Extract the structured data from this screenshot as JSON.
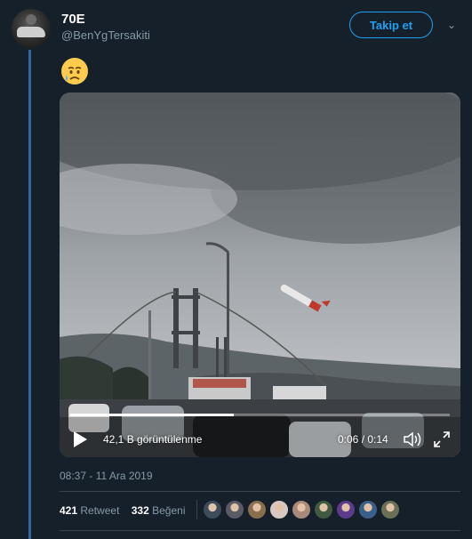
{
  "tweet": {
    "author_name": "70E",
    "author_handle": "@BenYgTersakiti",
    "follow_label": "Takip et",
    "emoji": "crying-face",
    "timestamp": "08:37 - 11 Ara 2019"
  },
  "video": {
    "views": "42,1 B görüntülenme",
    "time": "0:06 / 0:14",
    "progress": 0.43
  },
  "stats": {
    "retweets": "421",
    "retweet_label": "Retweet",
    "likes": "332",
    "like_label": "Beğeni"
  },
  "likers": [
    {
      "color": "#3d4b5a"
    },
    {
      "color": "#5b5b66"
    },
    {
      "color": "#8a6f4e"
    },
    {
      "color": "#d9c7c2"
    },
    {
      "color": "#a98a7a"
    },
    {
      "color": "#3f5a3f"
    },
    {
      "color": "#5c3a8c"
    },
    {
      "color": "#3a5f8a"
    },
    {
      "color": "#6b6f55"
    }
  ],
  "colors": {
    "background": "#15202b",
    "accent": "#1da1f2",
    "muted": "#8899a6",
    "thread": "#2f6aa3"
  }
}
